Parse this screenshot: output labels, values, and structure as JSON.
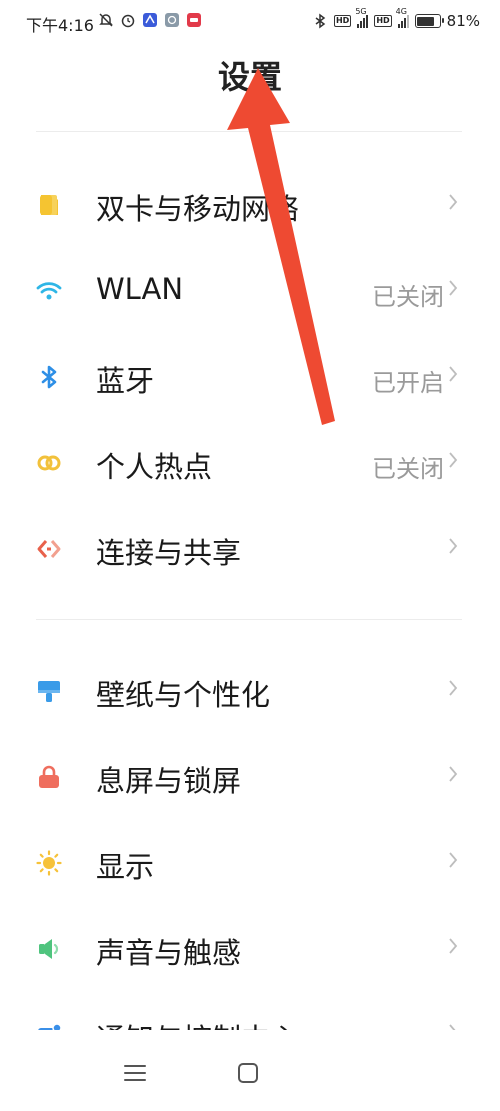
{
  "status_bar": {
    "time": "下午4:16",
    "battery_percent": "81%",
    "battery_level": 0.81,
    "network_1": "5G",
    "network_2": "4G",
    "hd_1": "HD",
    "hd_2": "HD"
  },
  "header": {
    "title": "设置"
  },
  "sections": [
    {
      "items": [
        {
          "label": "双卡与移动网络",
          "value": "",
          "icon": "sim-card-icon",
          "color": "#F5C431"
        },
        {
          "label": "WLAN",
          "value": "已关闭",
          "icon": "wifi-icon",
          "color": "#2FB6E6"
        },
        {
          "label": "蓝牙",
          "value": "已开启",
          "icon": "bluetooth-icon",
          "color": "#2E8FE6"
        },
        {
          "label": "个人热点",
          "value": "已关闭",
          "icon": "hotspot-icon",
          "color": "#F2C13B"
        },
        {
          "label": "连接与共享",
          "value": "",
          "icon": "connection-share-icon",
          "color": "#E8614B"
        }
      ]
    },
    {
      "items": [
        {
          "label": "壁纸与个性化",
          "value": "",
          "icon": "wallpaper-icon",
          "color": "#3A9BE8"
        },
        {
          "label": "息屏与锁屏",
          "value": "",
          "icon": "lock-icon",
          "color": "#EF6E5E"
        },
        {
          "label": "显示",
          "value": "",
          "icon": "sun-icon",
          "color": "#F6C23A"
        },
        {
          "label": "声音与触感",
          "value": "",
          "icon": "sound-icon",
          "color": "#4FC47E"
        },
        {
          "label": "通知与控制中心",
          "value": "",
          "icon": "notification-icon",
          "color": "#3A8FE8"
        }
      ]
    }
  ]
}
